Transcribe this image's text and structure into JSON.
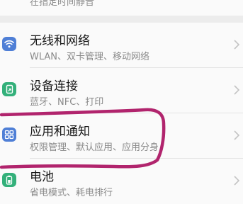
{
  "top_item": {
    "subtitle": "在指定时间静音"
  },
  "settings": [
    {
      "title": "无线和网络",
      "subtitle": "WLAN、双卡管理、移动网络",
      "icon": "wifi-icon",
      "color": "#4f7fd6"
    },
    {
      "title": "设备连接",
      "subtitle": "蓝牙、NFC、打印",
      "icon": "device-connection-icon",
      "color": "#33b07a"
    },
    {
      "title": "应用和通知",
      "subtitle": "权限管理、默认应用、应用分身",
      "icon": "apps-icon",
      "color": "#4f7fd6"
    },
    {
      "title": "电池",
      "subtitle": "省电模式、耗电排行",
      "icon": "battery-icon",
      "color": "#33b07a"
    }
  ],
  "annotation_color": "#b1246d",
  "chevron_color": "#c4c4c4"
}
